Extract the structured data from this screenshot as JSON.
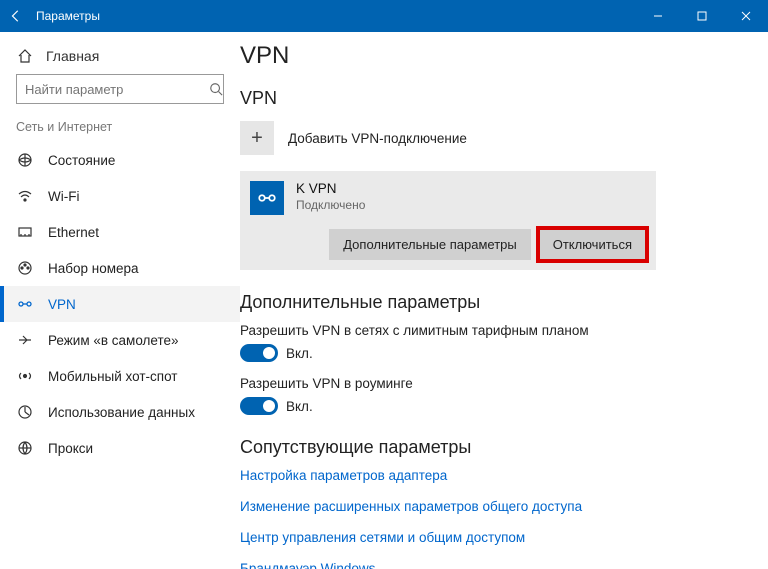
{
  "window": {
    "title": "Параметры"
  },
  "sidebar": {
    "home": "Главная",
    "search_placeholder": "Найти параметр",
    "group": "Сеть и Интернет",
    "items": [
      {
        "icon": "status-icon",
        "label": "Состояние",
        "selected": false
      },
      {
        "icon": "wifi-icon",
        "label": "Wi-Fi",
        "selected": false
      },
      {
        "icon": "ethernet-icon",
        "label": "Ethernet",
        "selected": false
      },
      {
        "icon": "dialup-icon",
        "label": "Набор номера",
        "selected": false
      },
      {
        "icon": "vpn-icon",
        "label": "VPN",
        "selected": true
      },
      {
        "icon": "airplane-icon",
        "label": "Режим «в самолете»",
        "selected": false
      },
      {
        "icon": "hotspot-icon",
        "label": "Мобильный хот-спот",
        "selected": false
      },
      {
        "icon": "data-icon",
        "label": "Использование данных",
        "selected": false
      },
      {
        "icon": "proxy-icon",
        "label": "Прокси",
        "selected": false
      }
    ]
  },
  "page": {
    "title": "VPN",
    "section_vpn": "VPN",
    "add_label": "Добавить VPN-подключение",
    "connection": {
      "name": "K             VPN",
      "status": "Подключено",
      "advanced_button": "Дополнительные параметры",
      "disconnect_button": "Отключиться"
    },
    "adv_header": "Дополнительные параметры",
    "settings": [
      {
        "label": "Разрешить VPN в сетях с лимитным тарифным планом",
        "on": true,
        "state_text": "Вкл."
      },
      {
        "label": "Разрешить VPN в роуминге",
        "on": true,
        "state_text": "Вкл."
      }
    ],
    "related_header": "Сопутствующие параметры",
    "links": [
      "Настройка параметров адаптера",
      "Изменение расширенных параметров общего доступа",
      "Центр управления сетями и общим доступом",
      "Брандмауэр Windows"
    ]
  }
}
